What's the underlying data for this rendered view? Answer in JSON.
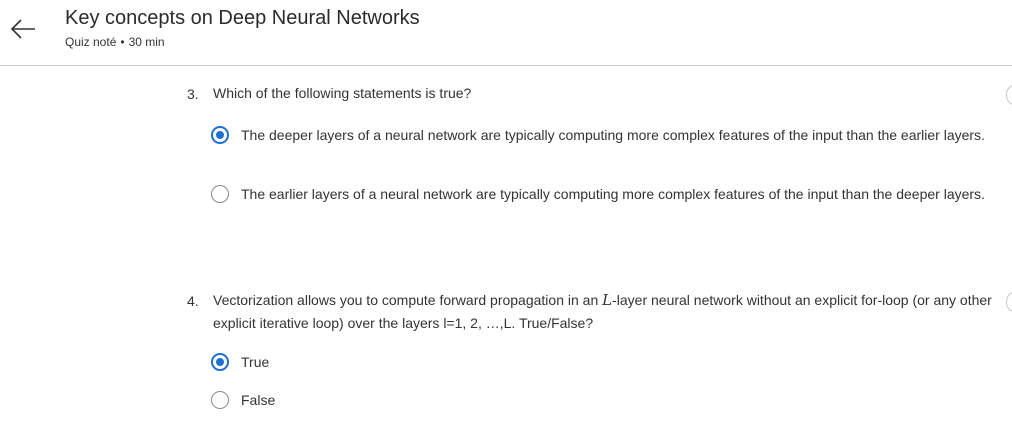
{
  "header": {
    "title": "Key concepts on Deep Neural Networks",
    "quiz_type": "Quiz noté",
    "separator": "•",
    "duration": "30 min"
  },
  "questions": [
    {
      "number": "3.",
      "text": "Which of the following statements is true?",
      "options": [
        {
          "label": "The deeper layers of a neural network are typically computing more complex features of the input than the earlier layers.",
          "selected": true
        },
        {
          "label": "The earlier layers of a neural network are typically computing more complex features of the input than the deeper layers.",
          "selected": false
        }
      ]
    },
    {
      "number": "4.",
      "text_before": "Vectorization allows you to compute forward propagation in an ",
      "math_symbol": "L",
      "text_after": "-layer neural network without an explicit for-loop (or any other explicit iterative loop) over the layers l=1, 2, …,L. True/False?",
      "options": [
        {
          "label": "True",
          "selected": true
        },
        {
          "label": "False",
          "selected": false
        }
      ]
    }
  ],
  "colors": {
    "accent": "#1f6fd1",
    "divider": "#cfcfcf"
  },
  "icons": {
    "back": "arrow-left-icon"
  }
}
